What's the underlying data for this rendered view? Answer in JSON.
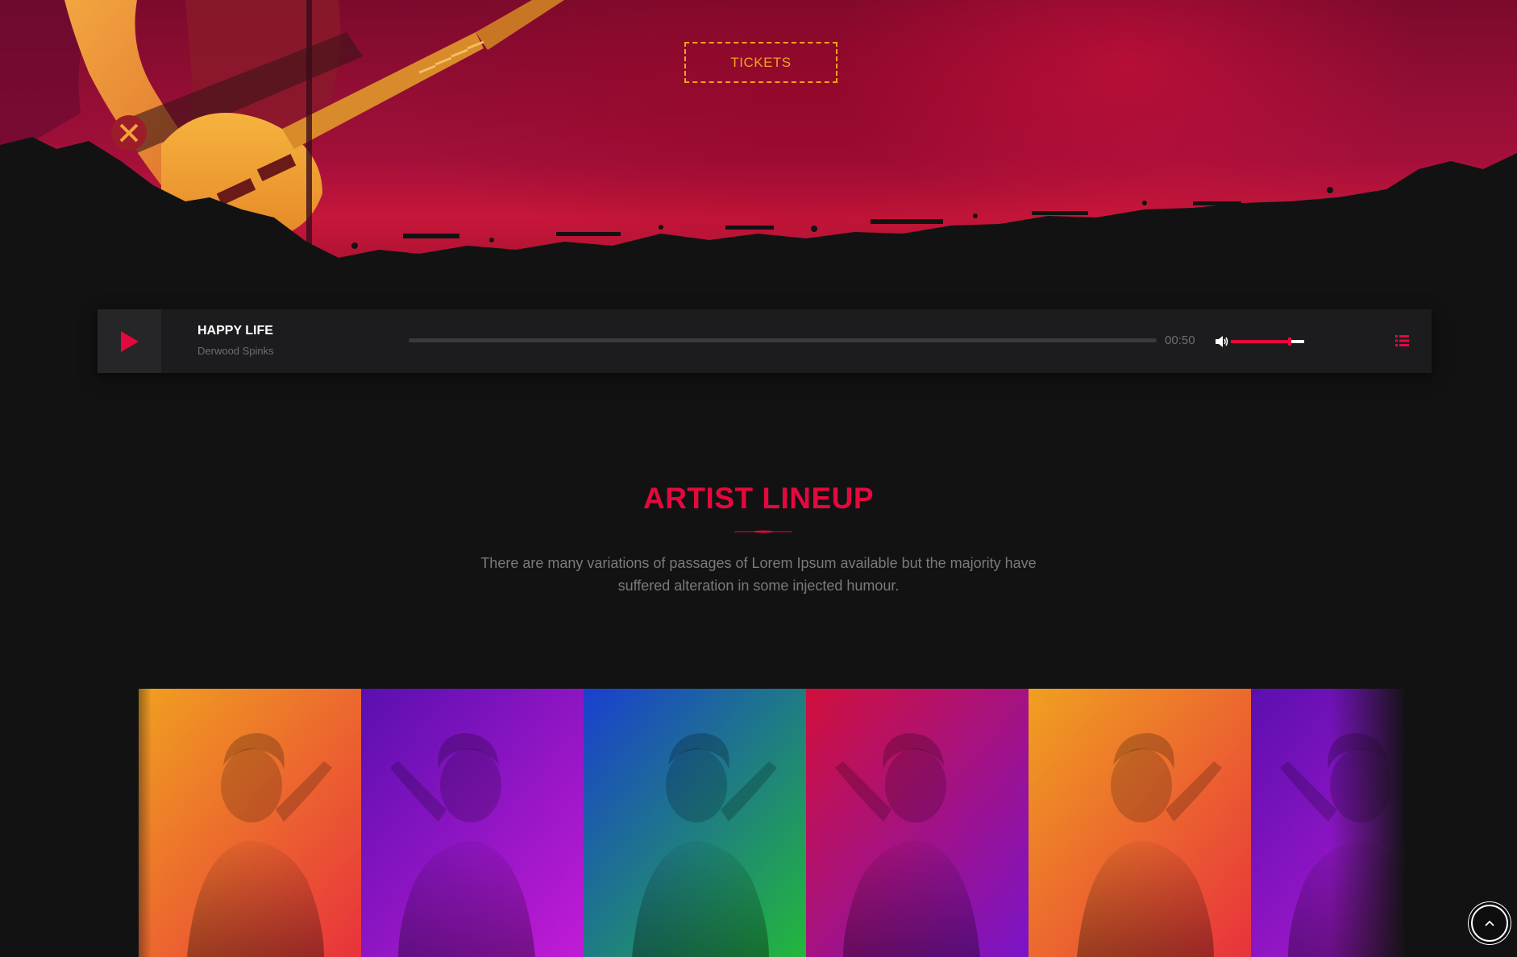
{
  "hero": {
    "tickets_label": "TICKETS"
  },
  "player": {
    "track_title": "HAPPY LIFE",
    "track_artist": "Derwood Spinks",
    "time": "00:50",
    "progress": 0.0,
    "volume": 0.8,
    "accent_color": "#e4093d",
    "icons": [
      "play-icon",
      "volume-icon",
      "playlist-icon"
    ]
  },
  "lineup": {
    "title": "ARTIST LINEUP",
    "description": "There are many variations of passages of Lorem Ipsum available but the majority have suffered alteration in some injected humour.",
    "artists": [
      {
        "tint": "orange-red",
        "from": "#f0a020",
        "to": "#e8323c"
      },
      {
        "tint": "purple",
        "from": "#5a0fb0",
        "to": "#c21bd6"
      },
      {
        "tint": "blue-green",
        "from": "#1a3fd0",
        "to": "#23b83a"
      },
      {
        "tint": "crimson-violet",
        "from": "#d0103c",
        "to": "#7a14c8"
      },
      {
        "tint": "orange-red",
        "from": "#f0a020",
        "to": "#e8323c"
      },
      {
        "tint": "purple",
        "from": "#5a0fb0",
        "to": "#c21bd6"
      }
    ]
  },
  "back_to_top": {
    "icon": "chevron-up-icon"
  }
}
